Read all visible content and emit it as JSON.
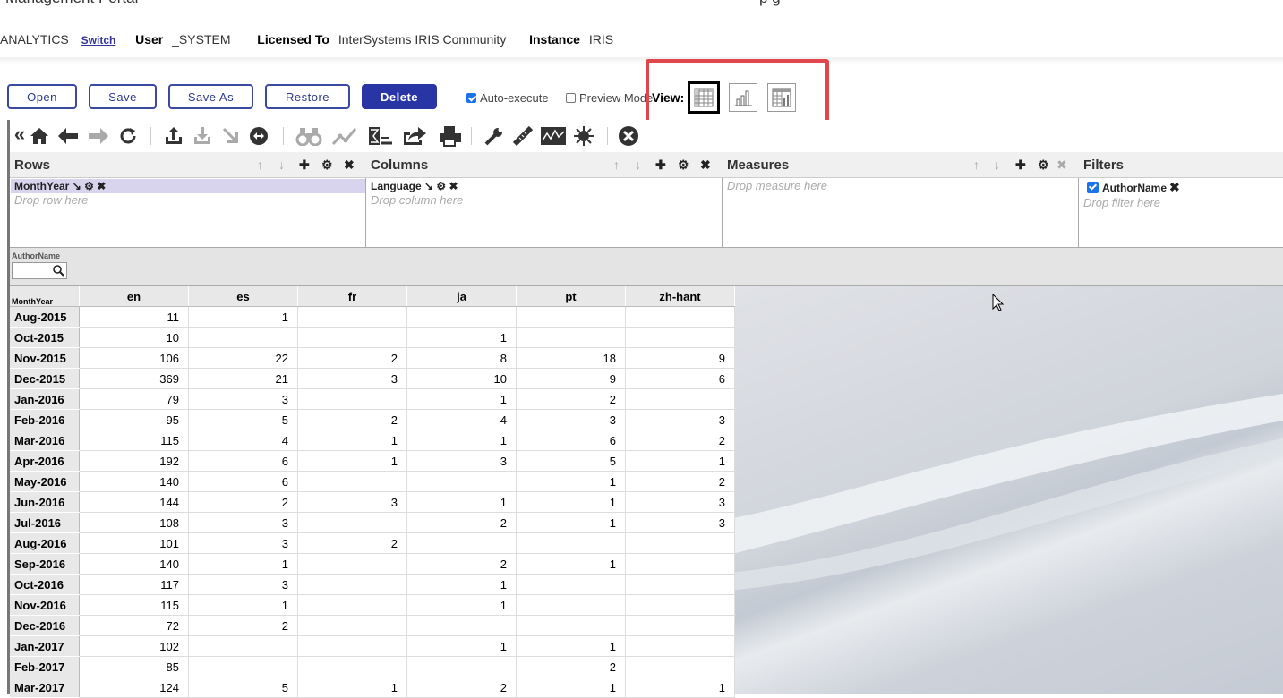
{
  "header": {
    "portal_title": "Management Portal",
    "portal_right": "p                    g",
    "namespace": "ANALYTICS",
    "switch_label": "Switch",
    "user_label": "User",
    "user_value": "_SYSTEM",
    "licensed_label": "Licensed To",
    "licensed_value": "InterSystems IRIS Community",
    "instance_label": "Instance",
    "instance_value": "IRIS"
  },
  "actions": {
    "open": "Open",
    "save": "Save",
    "save_as": "Save As",
    "restore": "Restore",
    "delete": "Delete",
    "auto_execute": "Auto-execute",
    "auto_execute_checked": true,
    "preview_mode": "Preview Mode",
    "preview_mode_checked": false,
    "view_label": "View:"
  },
  "toolbar": {
    "collapse_glyph": "«",
    "icons": [
      "home-icon",
      "back-arrow-icon",
      "forward-arrow-icon",
      "refresh-icon",
      "export-icon",
      "import-icon",
      "drill-icon",
      "swap-icon",
      "binoculars-icon",
      "line-chart-icon",
      "calc-member-icon",
      "share-icon",
      "print-icon",
      "wrench-icon",
      "ruler-icon",
      "sparkline-icon",
      "sun-icon",
      "close-circle-icon"
    ]
  },
  "panels": {
    "rows": {
      "title": "Rows",
      "chip": "MonthYear",
      "drop": "Drop row here"
    },
    "columns": {
      "title": "Columns",
      "chip": "Language",
      "drop": "Drop column here"
    },
    "measures": {
      "title": "Measures",
      "drop": "Drop measure here"
    },
    "filters": {
      "title": "Filters",
      "chip": "AuthorName",
      "drop": "Drop filter here"
    }
  },
  "filterbar": {
    "label": "AuthorName",
    "value": ""
  },
  "pivot": {
    "corner": "MonthYear",
    "columns": [
      "en",
      "es",
      "fr",
      "ja",
      "pt",
      "zh-hant"
    ],
    "rows": [
      {
        "label": "Aug-2015",
        "cells": [
          "11",
          "1",
          "",
          "",
          "",
          ""
        ]
      },
      {
        "label": "Oct-2015",
        "cells": [
          "10",
          "",
          "",
          "1",
          "",
          ""
        ]
      },
      {
        "label": "Nov-2015",
        "cells": [
          "106",
          "22",
          "2",
          "8",
          "18",
          "9"
        ]
      },
      {
        "label": "Dec-2015",
        "cells": [
          "369",
          "21",
          "3",
          "10",
          "9",
          "6"
        ]
      },
      {
        "label": "Jan-2016",
        "cells": [
          "79",
          "3",
          "",
          "1",
          "2",
          ""
        ]
      },
      {
        "label": "Feb-2016",
        "cells": [
          "95",
          "5",
          "2",
          "4",
          "3",
          "3"
        ]
      },
      {
        "label": "Mar-2016",
        "cells": [
          "115",
          "4",
          "1",
          "1",
          "6",
          "2"
        ]
      },
      {
        "label": "Apr-2016",
        "cells": [
          "192",
          "6",
          "1",
          "3",
          "5",
          "1"
        ]
      },
      {
        "label": "May-2016",
        "cells": [
          "140",
          "6",
          "",
          "",
          "1",
          "2"
        ]
      },
      {
        "label": "Jun-2016",
        "cells": [
          "144",
          "2",
          "3",
          "1",
          "1",
          "3"
        ]
      },
      {
        "label": "Jul-2016",
        "cells": [
          "108",
          "3",
          "",
          "2",
          "1",
          "3"
        ]
      },
      {
        "label": "Aug-2016",
        "cells": [
          "101",
          "3",
          "2",
          "",
          "",
          ""
        ]
      },
      {
        "label": "Sep-2016",
        "cells": [
          "140",
          "1",
          "",
          "2",
          "1",
          ""
        ]
      },
      {
        "label": "Oct-2016",
        "cells": [
          "117",
          "3",
          "",
          "1",
          "",
          ""
        ]
      },
      {
        "label": "Nov-2016",
        "cells": [
          "115",
          "1",
          "",
          "1",
          "",
          ""
        ]
      },
      {
        "label": "Dec-2016",
        "cells": [
          "72",
          "2",
          "",
          "",
          "",
          ""
        ]
      },
      {
        "label": "Jan-2017",
        "cells": [
          "102",
          "",
          "",
          "1",
          "1",
          ""
        ]
      },
      {
        "label": "Feb-2017",
        "cells": [
          "85",
          "",
          "",
          "",
          "2",
          ""
        ]
      },
      {
        "label": "Mar-2017",
        "cells": [
          "124",
          "5",
          "1",
          "2",
          "1",
          "1"
        ]
      }
    ]
  },
  "colors": {
    "accent": "#2a35a5",
    "highlight": "#e0474c",
    "toolbar_icon": "#333333"
  }
}
